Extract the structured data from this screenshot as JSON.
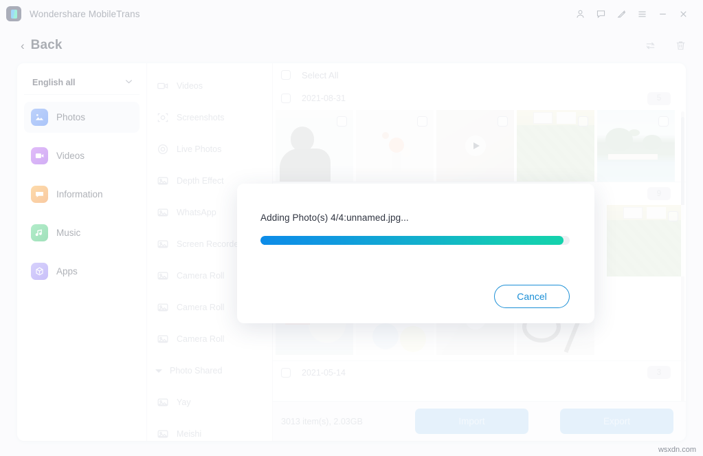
{
  "window": {
    "app_title": "Wondershare MobileTrans",
    "titlebar_buttons": [
      {
        "name": "account-icon",
        "label": "Account"
      },
      {
        "name": "feedback-icon",
        "label": "Feedback"
      },
      {
        "name": "edit-pen-icon",
        "label": "Edit"
      },
      {
        "name": "menu-icon",
        "label": "Menu"
      },
      {
        "name": "minimize-icon",
        "label": "Minimize"
      },
      {
        "name": "close-icon",
        "label": "Close"
      }
    ]
  },
  "subheader": {
    "back_label": "Back",
    "back_chevron": "‹",
    "actions": [
      {
        "name": "refresh-icon",
        "label": "Refresh"
      },
      {
        "name": "delete-icon",
        "label": "Delete"
      }
    ]
  },
  "sidebar": {
    "language_selector": {
      "value": "English all",
      "caret": "⌄"
    },
    "items": [
      {
        "label": "Photos",
        "icon": "photos-icon",
        "active": true
      },
      {
        "label": "Videos",
        "icon": "videos-icon",
        "active": false
      },
      {
        "label": "Information",
        "icon": "information-icon",
        "active": false
      },
      {
        "label": "Music",
        "icon": "music-icon",
        "active": false
      },
      {
        "label": "Apps",
        "icon": "apps-icon",
        "active": false
      }
    ]
  },
  "categories": [
    {
      "label": "Videos",
      "icon": "video-camera-icon",
      "type": "item"
    },
    {
      "label": "Screenshots",
      "icon": "screenshot-icon",
      "type": "item"
    },
    {
      "label": "Live Photos",
      "icon": "live-photo-icon",
      "type": "item"
    },
    {
      "label": "Depth Effect",
      "icon": "image-icon",
      "type": "item"
    },
    {
      "label": "WhatsApp",
      "icon": "image-icon",
      "type": "item"
    },
    {
      "label": "Screen Recorder",
      "icon": "image-icon",
      "type": "item"
    },
    {
      "label": "Camera Roll",
      "icon": "image-icon",
      "type": "item"
    },
    {
      "label": "Camera Roll",
      "icon": "image-icon",
      "type": "item"
    },
    {
      "label": "Camera Roll",
      "icon": "image-icon",
      "type": "item"
    },
    {
      "label": "Photo Shared",
      "icon": "caret-down-icon",
      "type": "group"
    },
    {
      "label": "Yay",
      "icon": "image-icon",
      "type": "item"
    },
    {
      "label": "Meishi",
      "icon": "image-icon",
      "type": "item"
    }
  ],
  "content": {
    "select_all_label": "Select All",
    "date_groups": [
      {
        "date": "2021-08-31",
        "count": "5",
        "thumbs": [
          {
            "name": "photo-person",
            "art": "art-person",
            "video": false
          },
          {
            "name": "photo-flowers",
            "art": "art-flower",
            "video": false
          },
          {
            "name": "video-thumbnail",
            "art": "art-video",
            "video": true
          },
          {
            "name": "photo-leaves",
            "art": "art-leaf",
            "video": false
          },
          {
            "name": "photo-palm-beach",
            "art": "art-palm",
            "video": false
          }
        ]
      },
      {
        "date": "",
        "count": "9",
        "thumbs": [
          {
            "name": "photo-leaves-2",
            "art": "art-leaf",
            "video": false
          }
        ]
      },
      {
        "date": "",
        "count": "",
        "thumbs": [
          {
            "name": "photo-illustration",
            "art": "art-totoro",
            "video": false
          },
          {
            "name": "photo-infographic",
            "art": "art-info",
            "video": false
          },
          {
            "name": "video-thumbnail-2",
            "art": "art-video2",
            "video": true
          },
          {
            "name": "photo-cables",
            "art": "art-cable",
            "video": false
          }
        ]
      },
      {
        "date": "2021-05-14",
        "count": "3",
        "thumbs": []
      }
    ]
  },
  "bottombar": {
    "count_text": "3013 item(s), 2.03GB",
    "import_label": "Import",
    "export_label": "Export"
  },
  "modal": {
    "message": "Adding Photo(s) 4/4:unnamed.jpg...",
    "progress_percent": 98,
    "cancel_label": "Cancel"
  },
  "watermark": "wsxdn.com",
  "colors": {
    "accent_blue": "#1b8fd6",
    "progress_start": "#0d8ce8",
    "progress_end": "#14d2ac",
    "page_bg": "#f4f6fa",
    "panel_bg": "#ffffff",
    "disabled_button": "#bedcf5"
  }
}
